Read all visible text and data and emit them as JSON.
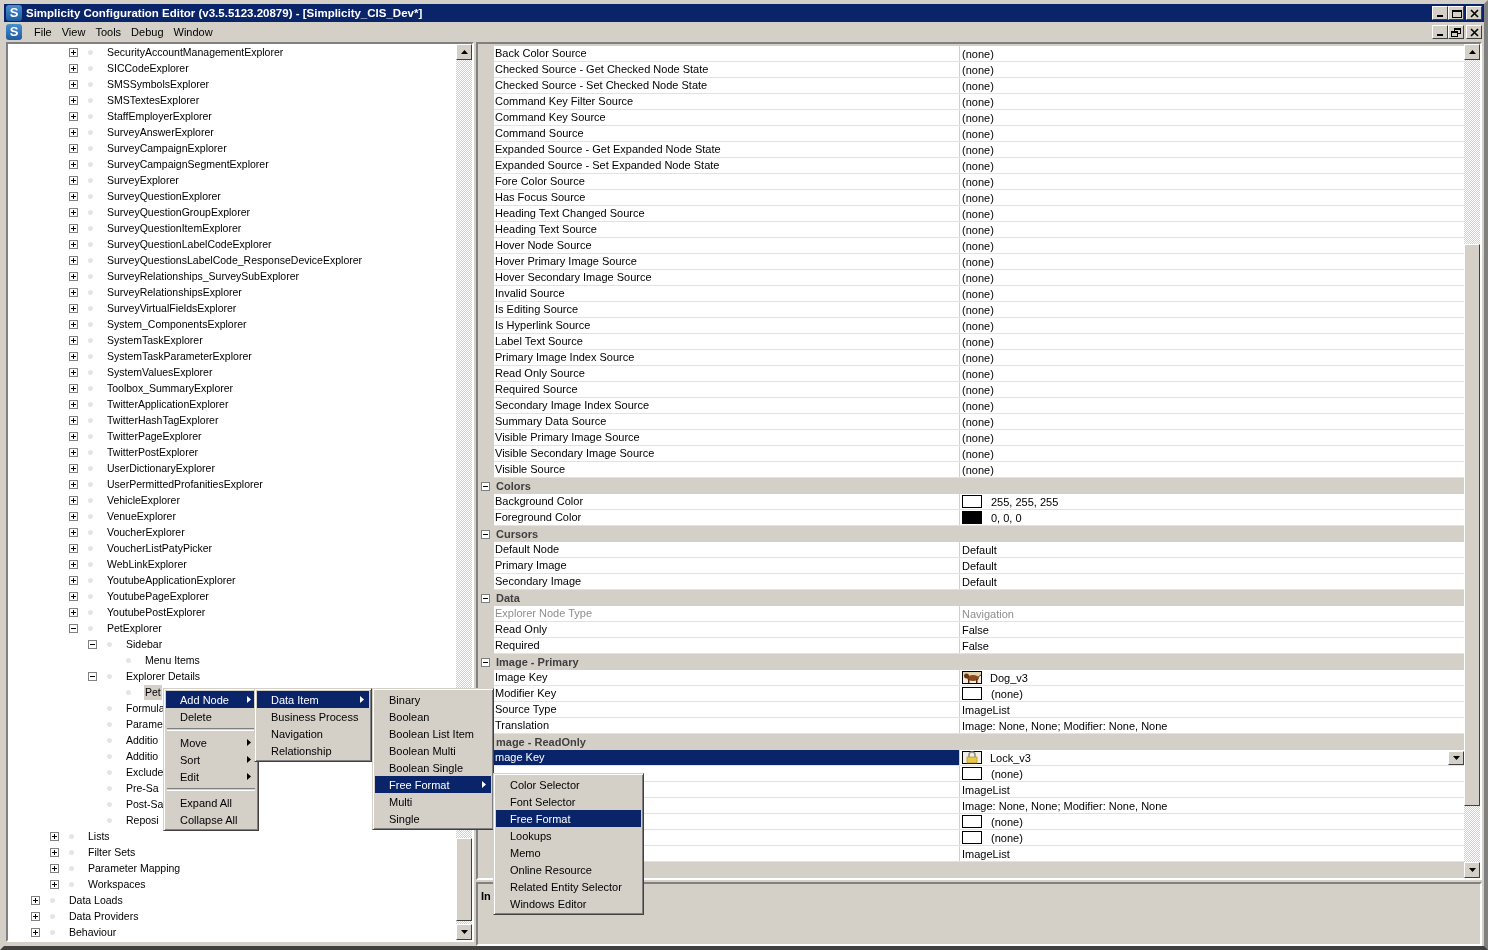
{
  "window": {
    "icon_text": "S",
    "title": "Simplicity Configuration Editor (v3.5.5123.20879) - [Simplicity_CIS_Dev*]"
  },
  "menu_bar": {
    "icon_text": "S",
    "items": [
      "File",
      "View",
      "Tools",
      "Debug",
      "Window"
    ]
  },
  "tree": {
    "items": [
      {
        "children": [
          {
            "children": [
              {
                "label": "SecurityAccountManagementExplorer",
                "expanded": false,
                "selected": false
              },
              {
                "label": "SICCodeExplorer",
                "expanded": false,
                "selected": false
              },
              {
                "label": "SMSSymbolsExplorer",
                "expanded": false,
                "selected": false
              },
              {
                "label": "SMSTextesExplorer",
                "expanded": false,
                "selected": false
              },
              {
                "label": "StaffEmployerExplorer",
                "expanded": false,
                "selected": false
              },
              {
                "label": "SurveyAnswerExplorer",
                "expanded": false,
                "selected": false
              },
              {
                "label": "SurveyCampaignExplorer",
                "expanded": false,
                "selected": false
              },
              {
                "label": "SurveyCampaignSegmentExplorer",
                "expanded": false,
                "selected": false
              },
              {
                "label": "SurveyExplorer",
                "expanded": false,
                "selected": false
              },
              {
                "label": "SurveyQuestionExplorer",
                "expanded": false,
                "selected": false
              },
              {
                "label": "SurveyQuestionGroupExplorer",
                "expanded": false,
                "selected": false
              },
              {
                "label": "SurveyQuestionItemExplorer",
                "expanded": false,
                "selected": false
              },
              {
                "label": "SurveyQuestionLabelCodeExplorer",
                "expanded": false,
                "selected": false
              },
              {
                "label": "SurveyQuestionsLabelCode_ResponseDeviceExplorer",
                "expanded": false,
                "selected": false
              },
              {
                "label": "SurveyRelationships_SurveySubExplorer",
                "expanded": false,
                "selected": false
              },
              {
                "label": "SurveyRelationshipsExplorer",
                "expanded": false,
                "selected": false
              },
              {
                "label": "SurveyVirtualFieldsExplorer",
                "expanded": false,
                "selected": false
              },
              {
                "label": "System_ComponentsExplorer",
                "expanded": false,
                "selected": false
              },
              {
                "label": "SystemTaskExplorer",
                "expanded": false,
                "selected": false
              },
              {
                "label": "SystemTaskParameterExplorer",
                "expanded": false,
                "selected": false
              },
              {
                "label": "SystemValuesExplorer",
                "expanded": false,
                "selected": false
              },
              {
                "label": "Toolbox_SummaryExplorer",
                "expanded": false,
                "selected": false
              },
              {
                "label": "TwitterApplicationExplorer",
                "expanded": false,
                "selected": false
              },
              {
                "label": "TwitterHashTagExplorer",
                "expanded": false,
                "selected": false
              },
              {
                "label": "TwitterPageExplorer",
                "expanded": false,
                "selected": false
              },
              {
                "label": "TwitterPostExplorer",
                "expanded": false,
                "selected": false
              },
              {
                "label": "UserDictionaryExplorer",
                "expanded": false,
                "selected": false
              },
              {
                "label": "UserPermittedProfanitiesExplorer",
                "expanded": false,
                "selected": false
              },
              {
                "label": "VehicleExplorer",
                "expanded": false,
                "selected": false
              },
              {
                "label": "VenueExplorer",
                "expanded": false,
                "selected": false
              },
              {
                "label": "VoucherExplorer",
                "expanded": false,
                "selected": false
              },
              {
                "label": "VoucherListPatyPicker",
                "expanded": false,
                "selected": false
              },
              {
                "label": "WebLinkExplorer",
                "expanded": false,
                "selected": false
              },
              {
                "label": "YoutubeApplicationExplorer",
                "expanded": false,
                "selected": false
              },
              {
                "label": "YoutubePageExplorer",
                "expanded": false,
                "selected": false
              },
              {
                "label": "YoutubePostExplorer",
                "expanded": false,
                "selected": false
              },
              {
                "label": "PetExplorer",
                "expanded": true,
                "selected": false,
                "children": [
                  {
                    "label": "Sidebar",
                    "expanded": true,
                    "selected": false,
                    "children": [
                      {
                        "label": "Menu Items",
                        "selected": false
                      }
                    ]
                  },
                  {
                    "label": "Explorer Details",
                    "expanded": true,
                    "selected": false,
                    "children": [
                      {
                        "label": "Pet",
                        "selected": true
                      }
                    ]
                  },
                  {
                    "label": "Formula",
                    "selected": false
                  },
                  {
                    "label": "Parame",
                    "selected": false
                  },
                  {
                    "label": "Additio",
                    "selected": false
                  },
                  {
                    "label": "Additio",
                    "selected": false
                  },
                  {
                    "label": "Exclude",
                    "selected": false
                  },
                  {
                    "label": "Pre-Sa",
                    "selected": false
                  },
                  {
                    "label": "Post-Sa",
                    "selected": false
                  },
                  {
                    "label": "Reposi",
                    "selected": false
                  }
                ]
              }
            ]
          },
          {
            "label": "Lists",
            "expanded": false,
            "selected": false
          },
          {
            "label": "Filter Sets",
            "expanded": false,
            "selected": false
          },
          {
            "label": "Parameter Mapping",
            "expanded": false,
            "selected": false
          },
          {
            "label": "Workspaces",
            "expanded": false,
            "selected": false
          }
        ]
      },
      {
        "label": "Data Loads",
        "expanded": false,
        "selected": false
      },
      {
        "label": "Data Providers",
        "expanded": false,
        "selected": false
      },
      {
        "label": "Behaviour",
        "expanded": false,
        "selected": false
      }
    ]
  },
  "property_grid": {
    "sections": [
      {
        "rows": [
          {
            "kind": "text",
            "name": "Back Color Source",
            "value": "(none)",
            "selected": false,
            "disabled": false
          },
          {
            "kind": "text",
            "name": "Checked Source - Get Checked Node State",
            "value": "(none)",
            "selected": false,
            "disabled": false
          },
          {
            "kind": "text",
            "name": "Checked Source - Set Checked Node State",
            "value": "(none)",
            "selected": false,
            "disabled": false
          },
          {
            "kind": "text",
            "name": "Command Key Filter Source",
            "value": "(none)",
            "selected": false,
            "disabled": false
          },
          {
            "kind": "text",
            "name": "Command Key Source",
            "value": "(none)",
            "selected": false,
            "disabled": false
          },
          {
            "kind": "text",
            "name": "Command Source",
            "value": "(none)",
            "selected": false,
            "disabled": false
          },
          {
            "kind": "text",
            "name": "Expanded Source - Get Expanded Node State",
            "value": "(none)",
            "selected": false,
            "disabled": false
          },
          {
            "kind": "text",
            "name": "Expanded Source - Set Expanded Node State",
            "value": "(none)",
            "selected": false,
            "disabled": false
          },
          {
            "kind": "text",
            "name": "Fore Color Source",
            "value": "(none)",
            "selected": false,
            "disabled": false
          },
          {
            "kind": "text",
            "name": "Has Focus Source",
            "value": "(none)",
            "selected": false,
            "disabled": false
          },
          {
            "kind": "text",
            "name": "Heading Text Changed Source",
            "value": "(none)",
            "selected": false,
            "disabled": false
          },
          {
            "kind": "text",
            "name": "Heading Text Source",
            "value": "(none)",
            "selected": false,
            "disabled": false
          },
          {
            "kind": "text",
            "name": "Hover Node Source",
            "value": "(none)",
            "selected": false,
            "disabled": false
          },
          {
            "kind": "text",
            "name": "Hover Primary Image Source",
            "value": "(none)",
            "selected": false,
            "disabled": false
          },
          {
            "kind": "text",
            "name": "Hover Secondary Image Source",
            "value": "(none)",
            "selected": false,
            "disabled": false
          },
          {
            "kind": "text",
            "name": "Invalid Source",
            "value": "(none)",
            "selected": false,
            "disabled": false
          },
          {
            "kind": "text",
            "name": "Is Editing Source",
            "value": "(none)",
            "selected": false,
            "disabled": false
          },
          {
            "kind": "text",
            "name": "Is Hyperlink Source",
            "value": "(none)",
            "selected": false,
            "disabled": false
          },
          {
            "kind": "text",
            "name": "Label Text Source",
            "value": "(none)",
            "selected": false,
            "disabled": false
          },
          {
            "kind": "text",
            "name": "Primary Image Index Source",
            "value": "(none)",
            "selected": false,
            "disabled": false
          },
          {
            "kind": "text",
            "name": "Read Only Source",
            "value": "(none)",
            "selected": false,
            "disabled": false
          },
          {
            "kind": "text",
            "name": "Required Source",
            "value": "(none)",
            "selected": false,
            "disabled": false
          },
          {
            "kind": "text",
            "name": "Secondary Image Index Source",
            "value": "(none)",
            "selected": false,
            "disabled": false
          },
          {
            "kind": "text",
            "name": "Summary Data Source",
            "value": "(none)",
            "selected": false,
            "disabled": false
          },
          {
            "kind": "text",
            "name": "Visible Primary Image Source",
            "value": "(none)",
            "selected": false,
            "disabled": false
          },
          {
            "kind": "text",
            "name": "Visible Secondary Image Source",
            "value": "(none)",
            "selected": false,
            "disabled": false
          },
          {
            "kind": "text",
            "name": "Visible Source",
            "value": "(none)",
            "selected": false,
            "disabled": false
          }
        ]
      },
      {
        "name": "Colors",
        "expanded": true,
        "rows": [
          {
            "kind": "swatch",
            "name": "Background Color",
            "value": "255, 255, 255",
            "color": "#ffffff",
            "selected": false,
            "disabled": false
          },
          {
            "kind": "swatch",
            "name": "Foreground Color",
            "value": "0, 0, 0",
            "color": "#000000",
            "selected": false,
            "disabled": false
          }
        ]
      },
      {
        "name": "Cursors",
        "expanded": true,
        "rows": [
          {
            "kind": "text",
            "name": "Default Node",
            "value": "Default",
            "selected": false,
            "disabled": false
          },
          {
            "kind": "text",
            "name": "Primary Image",
            "value": "Default",
            "selected": false,
            "disabled": false
          },
          {
            "kind": "text",
            "name": "Secondary Image",
            "value": "Default",
            "selected": false,
            "disabled": false
          }
        ]
      },
      {
        "name": "Data",
        "expanded": true,
        "rows": [
          {
            "kind": "text",
            "name": "Explorer Node Type",
            "value": "Navigation",
            "selected": false,
            "disabled": true
          },
          {
            "kind": "text",
            "name": "Read Only",
            "value": "False",
            "selected": false,
            "disabled": false
          },
          {
            "kind": "text",
            "name": "Required",
            "value": "False",
            "selected": false,
            "disabled": false
          }
        ]
      },
      {
        "name": "Image - Primary",
        "expanded": true,
        "rows": [
          {
            "name": "Image Key",
            "value": "Dog_v3",
            "selected": false,
            "disabled": false
          },
          {
            "kind": "blank",
            "name": "Modifier Key",
            "value": "(none)",
            "selected": false,
            "disabled": false
          },
          {
            "kind": "text",
            "name": "Source Type",
            "value": "ImageList",
            "selected": false,
            "disabled": false
          },
          {
            "kind": "text",
            "name": "Translation",
            "value": "Image: None, None; Modifier: None, None",
            "selected": false,
            "disabled": false
          }
        ]
      },
      {
        "name": "mage - ReadOnly",
        "rows": [
          {
            "name": "mage Key",
            "value": "Lock_v3",
            "selected": true,
            "disabled": false
          },
          {
            "kind": "blank",
            "value": "(none)",
            "selected": false,
            "disabled": false
          },
          {
            "kind": "text",
            "value": "ImageList",
            "selected": false,
            "disabled": false
          },
          {
            "kind": "text",
            "value": "Image: None, None; Modifier: None, None",
            "selected": false,
            "disabled": false
          }
        ]
      },
      {
        "rows": [
          {
            "kind": "blank",
            "value": "(none)",
            "selected": false,
            "disabled": false
          },
          {
            "kind": "blank",
            "value": "(none)",
            "selected": false,
            "disabled": false
          },
          {
            "kind": "text",
            "value": "ImageList",
            "selected": false,
            "disabled": false
          }
        ]
      }
    ],
    "description": {
      "title": "In"
    }
  },
  "context_menus": [
    {
      "items": [
        {
          "kind": "item",
          "label": "Add Node",
          "selected": true,
          "submenu": true
        },
        {
          "kind": "item",
          "label": "Delete",
          "selected": false,
          "submenu": false
        },
        {
          "kind": "separator"
        },
        {
          "kind": "item",
          "label": "Move",
          "selected": false,
          "submenu": true
        },
        {
          "kind": "item",
          "label": "Sort",
          "selected": false,
          "submenu": true
        },
        {
          "kind": "item",
          "label": "Edit",
          "selected": false,
          "submenu": true
        },
        {
          "kind": "separator"
        },
        {
          "kind": "item",
          "label": "Expand All",
          "selected": false,
          "submenu": false
        },
        {
          "kind": "item",
          "label": "Collapse All",
          "selected": false,
          "submenu": false
        }
      ]
    },
    {
      "items": [
        {
          "kind": "item",
          "label": "Data Item",
          "selected": true,
          "submenu": true
        },
        {
          "kind": "item",
          "label": "Business Process",
          "selected": false,
          "submenu": false
        },
        {
          "kind": "item",
          "label": "Navigation",
          "selected": false,
          "submenu": false
        },
        {
          "kind": "item",
          "label": "Relationship",
          "selected": false,
          "submenu": false
        }
      ]
    },
    {
      "items": [
        {
          "kind": "item",
          "label": "Binary",
          "selected": false,
          "submenu": false
        },
        {
          "kind": "item",
          "label": "Boolean",
          "selected": false,
          "submenu": false
        },
        {
          "kind": "item",
          "label": "Boolean List Item",
          "selected": false,
          "submenu": false
        },
        {
          "kind": "item",
          "label": "Boolean Multi",
          "selected": false,
          "submenu": false
        },
        {
          "kind": "item",
          "label": "Boolean Single",
          "selected": false,
          "submenu": false
        },
        {
          "kind": "item",
          "label": "Free Format",
          "selected": true,
          "submenu": true
        },
        {
          "kind": "item",
          "label": "Multi",
          "selected": false,
          "submenu": false
        },
        {
          "kind": "item",
          "label": "Single",
          "selected": false,
          "submenu": false
        }
      ]
    },
    {
      "items": [
        {
          "kind": "item",
          "label": "Color Selector",
          "selected": false,
          "submenu": false
        },
        {
          "kind": "item",
          "label": "Font Selector",
          "selected": false,
          "submenu": false
        },
        {
          "kind": "item",
          "label": "Free Format",
          "selected": true,
          "submenu": false
        },
        {
          "kind": "item",
          "label": "Lookups",
          "selected": false,
          "submenu": false
        },
        {
          "kind": "item",
          "label": "Memo",
          "selected": false,
          "submenu": false
        },
        {
          "kind": "item",
          "label": "Online Resource",
          "selected": false,
          "submenu": false
        },
        {
          "kind": "item",
          "label": "Related Entity Selector",
          "selected": false,
          "submenu": false
        },
        {
          "kind": "item",
          "label": "Windows Editor",
          "selected": false,
          "submenu": false
        }
      ]
    }
  ]
}
